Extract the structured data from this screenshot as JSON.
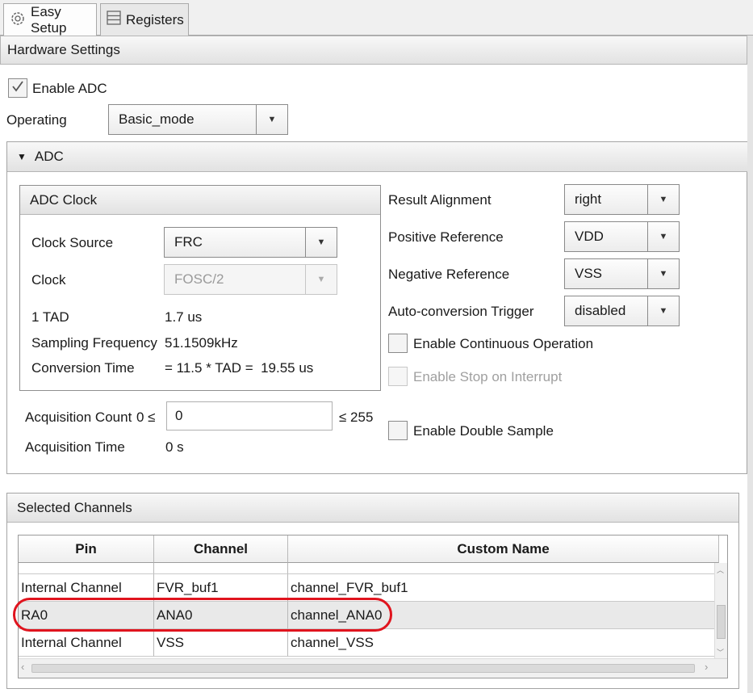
{
  "tabs": [
    {
      "label": "Easy Setup",
      "icon": "gear-icon"
    },
    {
      "label": "Registers",
      "icon": "registers-icon"
    }
  ],
  "hardware_settings": {
    "title": "Hardware Settings",
    "enable_adc": {
      "label": "Enable ADC",
      "checked": true
    },
    "operating": {
      "label": "Operating",
      "value": "Basic_mode"
    }
  },
  "adc": {
    "title": "ADC",
    "clock_group": {
      "title": "ADC Clock",
      "clock_source": {
        "label": "Clock Source",
        "value": "FRC"
      },
      "clock": {
        "label": "Clock",
        "value": "FOSC/2"
      },
      "tad": {
        "label": "1 TAD",
        "value": "1.7 us"
      },
      "sampling_frequency": {
        "label": "Sampling Frequency",
        "value": "51.1509kHz"
      },
      "conversion_time": {
        "label": "Conversion Time",
        "value": "= 11.5 * TAD =  19.55 us"
      }
    },
    "acquisition_count": {
      "label": "Acquisition Count",
      "min": "0 ≤",
      "value": "0",
      "max": "≤ 255"
    },
    "acquisition_time": {
      "label": "Acquisition Time",
      "value": "0 s"
    },
    "result_alignment": {
      "label": "Result Alignment",
      "value": "right"
    },
    "positive_reference": {
      "label": "Positive Reference",
      "value": "VDD"
    },
    "negative_reference": {
      "label": "Negative Reference",
      "value": "VSS"
    },
    "auto_conversion_trigger": {
      "label": "Auto-conversion Trigger",
      "value": "disabled"
    },
    "enable_continuous": {
      "label": "Enable Continuous Operation",
      "checked": false
    },
    "enable_stop_on_interrupt": {
      "label": "Enable Stop on Interrupt",
      "checked": false,
      "disabled": true
    },
    "enable_double_sample": {
      "label": "Enable Double Sample",
      "checked": false
    }
  },
  "selected_channels": {
    "title": "Selected Channels",
    "columns": [
      "Pin",
      "Channel",
      "Custom Name"
    ],
    "rows": [
      {
        "pin": "Internal Channel",
        "channel": "FVR_buf1",
        "custom_name": "channel_FVR_buf1"
      },
      {
        "pin": "RA0",
        "channel": "ANA0",
        "custom_name": "channel_ANA0",
        "highlighted": true
      },
      {
        "pin": "Internal Channel",
        "channel": "VSS",
        "custom_name": "channel_VSS"
      }
    ]
  },
  "colors": {
    "highlight_outline": "#e0141e",
    "selected_row": "#e9e9e9"
  }
}
